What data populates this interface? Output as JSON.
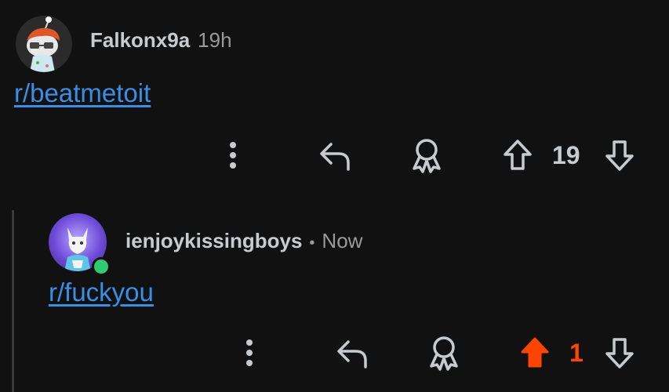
{
  "comments": [
    {
      "username": "Falkonx9a",
      "time": "19h",
      "body_link": "r/beatmetoit",
      "score": "19",
      "upvoted": false
    },
    {
      "username": "ienjoykissingboys",
      "separator": "•",
      "time": "Now",
      "body_link": "r/fuckyou",
      "score": "1",
      "upvoted": true,
      "online": true
    }
  ],
  "icons": {
    "more": "more-vertical-icon",
    "reply": "reply-arrow-icon",
    "award": "award-icon",
    "upvote": "arrow-up-icon",
    "downvote": "arrow-down-icon"
  },
  "colors": {
    "background": "#111111",
    "link": "#3a8ee6",
    "upvote_active": "#ff4500",
    "icon": "#c8cbcd",
    "online": "#2ecc71"
  }
}
